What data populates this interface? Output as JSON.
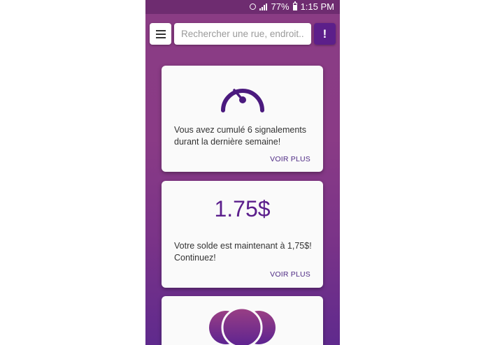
{
  "status": {
    "percent": "77%",
    "time": "1:15 PM"
  },
  "search": {
    "placeholder": "Rechercher une rue, endroit.."
  },
  "alert_button": {
    "label": "!"
  },
  "cards": [
    {
      "icon": "speedometer-icon",
      "text_line1": "Vous avez cumulé  6 signalements",
      "text_line2": "durant la dernière semaine!",
      "action": "VOIR PLUS"
    },
    {
      "amount": "1.75$",
      "text_line1": "Votre solde est maintenant à 1,75$!",
      "text_line2": "Continuez!",
      "action": "VOIR PLUS"
    },
    {
      "icon": "overlapping-circles-icon"
    }
  ],
  "colors": {
    "accent": "#5c1f8a",
    "background_top": "#8a3c84",
    "background_bottom": "#5f2a8d"
  }
}
